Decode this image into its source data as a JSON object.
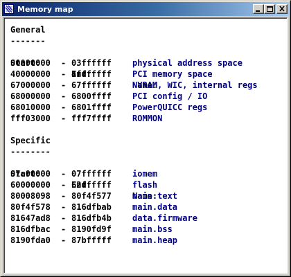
{
  "window": {
    "title": "Memory map",
    "icon": "memory-map-icon",
    "controls": {
      "minimize": "minimize-icon",
      "maximize": "maximize-icon",
      "close": "close-icon"
    }
  },
  "general": {
    "heading": "General",
    "underline": "-------",
    "col_start": "Start:",
    "col_end": "End:",
    "col_name": "Name:",
    "rows": [
      {
        "start": "00000000",
        "dash": "-",
        "end": "03ffffff",
        "name": "physical address space"
      },
      {
        "start": "40000000",
        "dash": "-",
        "end": "4fffffff",
        "name": "PCI memory space"
      },
      {
        "start": "67000000",
        "dash": "-",
        "end": "67ffffff",
        "name": "NVRAM, WIC, internal regs"
      },
      {
        "start": "68000000",
        "dash": "-",
        "end": "6800ffff",
        "name": "PCI config / IO"
      },
      {
        "start": "68010000",
        "dash": "-",
        "end": "6801ffff",
        "name": "PowerQUICC regs"
      },
      {
        "start": "fff03000",
        "dash": "-",
        "end": "fff7ffff",
        "name": "ROMMON"
      }
    ]
  },
  "specific": {
    "heading": "Specific",
    "underline": "--------",
    "col_start": "Start:",
    "col_end": "End:",
    "col_name": "Name:",
    "rows": [
      {
        "start": "07c00000",
        "dash": "-",
        "end": "07ffffff",
        "name": "iomem"
      },
      {
        "start": "60000000",
        "dash": "-",
        "end": "62ffffff",
        "name": "flash"
      },
      {
        "start": "80008098",
        "dash": "-",
        "end": "80f4f577",
        "name": "main.text"
      },
      {
        "start": "80f4f578",
        "dash": "-",
        "end": "816dfbab",
        "name": "main.data"
      },
      {
        "start": "81647ad8",
        "dash": "-",
        "end": "816dfb4b",
        "name": "data.firmware"
      },
      {
        "start": "816dfbac",
        "dash": "-",
        "end": "8190fd9f",
        "name": "main.bss"
      },
      {
        "start": "8190fda0",
        "dash": "-",
        "end": "87bfffff",
        "name": "main.heap"
      }
    ]
  },
  "colors": {
    "titlebar_start": "#0a246a",
    "titlebar_end": "#a6caf0",
    "name_text": "#00007f",
    "body_text": "#000000"
  }
}
